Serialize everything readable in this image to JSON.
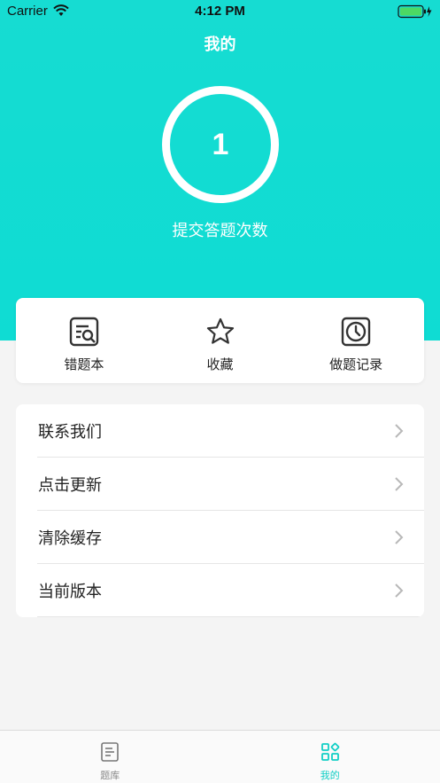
{
  "status_bar": {
    "carrier": "Carrier",
    "time": "4:12 PM"
  },
  "header": {
    "title": "我的"
  },
  "stats": {
    "count": "1",
    "label": "提交答题次数"
  },
  "quick_actions": [
    {
      "label": "错题本",
      "icon": "wrong-book-icon"
    },
    {
      "label": "收藏",
      "icon": "star-icon"
    },
    {
      "label": "做题记录",
      "icon": "clock-icon"
    }
  ],
  "settings": [
    {
      "label": "联系我们"
    },
    {
      "label": "点击更新"
    },
    {
      "label": "清除缓存"
    },
    {
      "label": "当前版本"
    }
  ],
  "tabs": [
    {
      "label": "题库",
      "icon": "document-icon",
      "active": false
    },
    {
      "label": "我的",
      "icon": "apps-icon",
      "active": true
    }
  ],
  "colors": {
    "accent": "#11cfc6",
    "hero": "#12dcd2",
    "battery": "#4cd964"
  }
}
